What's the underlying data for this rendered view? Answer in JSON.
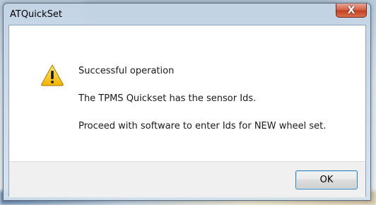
{
  "window": {
    "title": "ATQuickSet",
    "close_glyph": "X"
  },
  "dialog": {
    "icon": "warning-icon",
    "lines": [
      "Successful operation",
      "The TPMS Quickset has the sensor Ids.",
      "Proceed with software to enter Ids for NEW wheel set."
    ],
    "ok_label": "OK"
  },
  "colors": {
    "close_button": "#c23f26",
    "ok_border": "#3c7fb1",
    "warning_yellow": "#f4c20d"
  }
}
